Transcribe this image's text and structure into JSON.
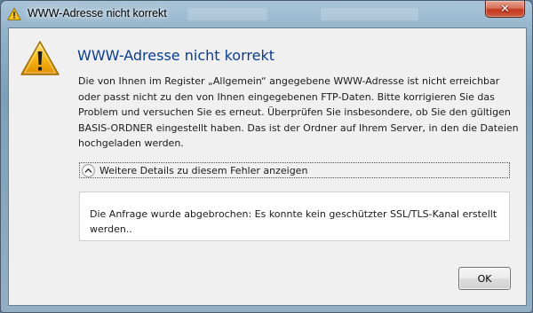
{
  "window": {
    "title": "WWW-Adresse nicht korrekt",
    "title_icon": "warning-icon",
    "close_glyph": "✕"
  },
  "dialog": {
    "icon": "warning-icon",
    "heading": "WWW-Adresse nicht korrekt",
    "message": "Die von Ihnen im Register „Allgemein“ angegebene WWW-Adresse ist nicht erreichbar oder passt nicht zu den von Ihnen eingegebenen FTP-Daten. Bitte korrigieren Sie das Problem und versuchen Sie es erneut. Überprüfen Sie insbesondere, ob Sie den gültigen BASIS-ORDNER eingestellt haben. Das ist der Ordner auf Ihrem Server, in den die Dateien hochgeladen werden.",
    "details_toggle_label": "Weitere Details zu diesem Fehler anzeigen",
    "details_toggle_icon": "chevron-up-icon",
    "details_text": "Die Anfrage wurde abgebrochen: Es konnte kein geschützter SSL/TLS-Kanal erstellt werden..",
    "ok_label": "OK"
  },
  "colors": {
    "heading": "#0a3d8f",
    "client_background": "#f0f0f0",
    "close_button": "#c3371f",
    "warning_fill": "#f5b400"
  }
}
